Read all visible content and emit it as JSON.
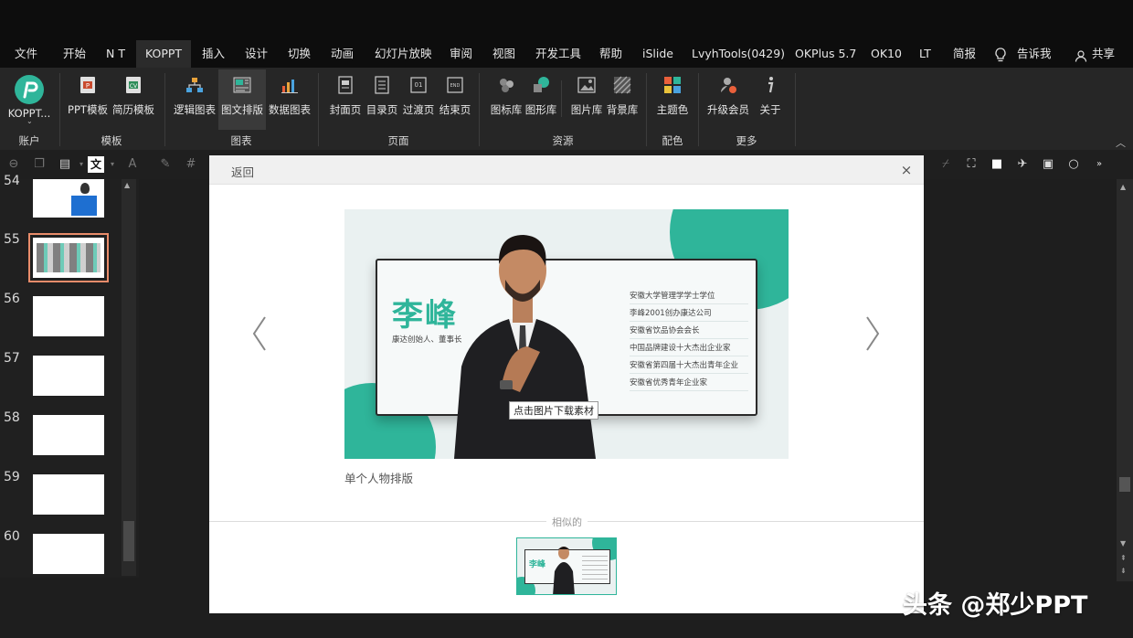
{
  "menubar": {
    "items": [
      "文件",
      "开始",
      "N T",
      "KOPPT",
      "插入",
      "设计",
      "切换",
      "动画",
      "幻灯片放映",
      "审阅",
      "视图",
      "开发工具",
      "帮助",
      "iSlide",
      "LvyhTools(0429)",
      "OKPlus 5.7",
      "OK10",
      "LT",
      "简报",
      "告诉我",
      "共享"
    ],
    "active": "KOPPT"
  },
  "ribbon": {
    "buttons": {
      "koppt": "KOPPT...",
      "ppt_template": "PPT模板",
      "resume_template": "简历模板",
      "logic_chart": "逻辑图表",
      "text_image_layout": "图文排版",
      "data_chart": "数据图表",
      "cover_page": "封面页",
      "toc_page": "目录页",
      "transition_page": "过渡页",
      "end_page": "结束页",
      "icon_library": "图标库",
      "shape_library": "图形库",
      "image_library": "图片库",
      "background_library": "背景库",
      "theme_color": "主题色",
      "upgrade_member": "升级会员",
      "about": "关于"
    },
    "groups": {
      "account": "账户",
      "template": "模板",
      "chart": "图表",
      "page": "页面",
      "resource": "资源",
      "color": "配色",
      "more": "更多"
    }
  },
  "slides": {
    "numbers": [
      "54",
      "55",
      "56",
      "57",
      "58",
      "59",
      "60"
    ],
    "selected": "55"
  },
  "dialog": {
    "back": "返回",
    "close": "×",
    "preview": {
      "name": "李峰",
      "subtitle": "康达创始人、董事长",
      "bio": [
        "安徽大学管理学学士学位",
        "李峰2001创办康达公司",
        "安徽省饮品协会会长",
        "中国品牌建设十大杰出企业家",
        "安徽省第四届十大杰出青年企业",
        "安徽省优秀青年企业家"
      ],
      "download_tip": "点击图片下载素材"
    },
    "caption": "单个人物排版",
    "similar_label": "相似的",
    "similar_thumb_name": "李峰"
  },
  "watermark": "头条 @郑少PPT",
  "colors": {
    "accent": "#2fb59a",
    "selected_outline": "#e98c6a"
  }
}
